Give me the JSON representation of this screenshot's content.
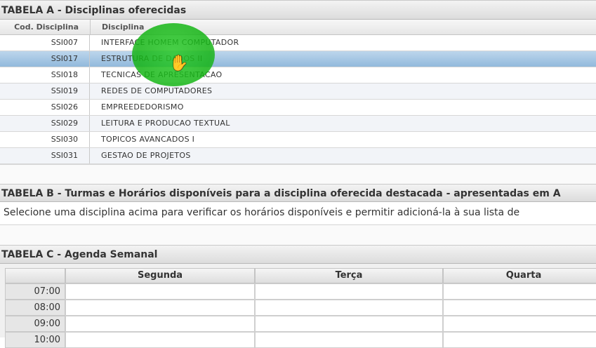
{
  "tableA": {
    "title": "TABELA A - Disciplinas oferecidas",
    "col_code": "Cod. Disciplina",
    "col_name": "Disciplina",
    "rows": [
      {
        "code": "SSI007",
        "name": "INTERFACE HOMEM COMPUTADOR"
      },
      {
        "code": "SSI017",
        "name": "ESTRUTURA DE DADOS II"
      },
      {
        "code": "SSI018",
        "name": "TECNICAS DE APRESENTACAO"
      },
      {
        "code": "SSI019",
        "name": "REDES DE COMPUTADORES"
      },
      {
        "code": "SSI026",
        "name": "EMPREEDEDORISMO"
      },
      {
        "code": "SSI029",
        "name": "LEITURA E PRODUCAO TEXTUAL"
      },
      {
        "code": "SSI030",
        "name": "TOPICOS AVANCADOS I"
      },
      {
        "code": "SSI031",
        "name": "GESTAO DE PROJETOS"
      }
    ],
    "selected_index": 1
  },
  "tableB": {
    "title": "TABELA B - Turmas e Horários disponíveis para a disciplina oferecida destacada - apresentadas em A",
    "message": "Selecione uma disciplina acima para verificar os horários disponíveis e permitir adicioná-la à sua lista de"
  },
  "tableC": {
    "title": "TABELA C - Agenda Semanal",
    "days": [
      "Segunda",
      "Terça",
      "Quarta"
    ],
    "times": [
      "07:00",
      "08:00",
      "09:00",
      "10:00"
    ]
  },
  "colors": {
    "selected_row": "#a8c8e4",
    "cursor_highlight": "#22b422"
  },
  "icons": {
    "cursor": "hand-pointer-icon"
  }
}
